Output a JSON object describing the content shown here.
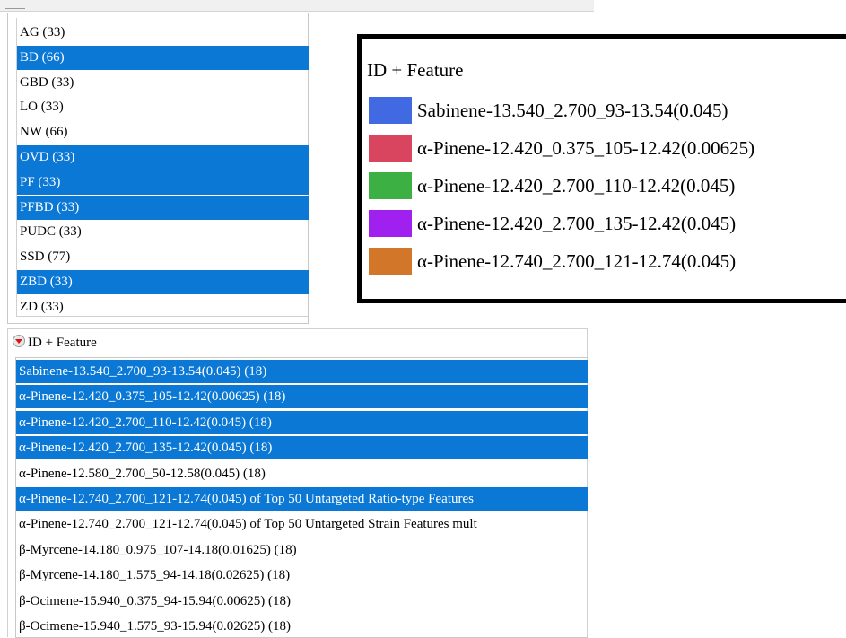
{
  "groups": [
    {
      "label": "AG (33)",
      "selected": false
    },
    {
      "label": "BD (66)",
      "selected": true
    },
    {
      "label": "GBD (33)",
      "selected": false
    },
    {
      "label": "LO (33)",
      "selected": false
    },
    {
      "label": "NW (66)",
      "selected": false
    },
    {
      "label": "OVD (33)",
      "selected": true
    },
    {
      "label": "PF (33)",
      "selected": true
    },
    {
      "label": "PFBD (33)",
      "selected": true
    },
    {
      "label": "PUDC (33)",
      "selected": false
    },
    {
      "label": "SSD (77)",
      "selected": false
    },
    {
      "label": "ZBD (33)",
      "selected": true
    },
    {
      "label": "ZD (33)",
      "selected": false
    }
  ],
  "legend": {
    "title": "ID + Feature",
    "items": [
      {
        "label": "Sabinene-13.540_2.700_93-13.54(0.045)",
        "color": "#4169e1"
      },
      {
        "label": "α-Pinene-12.420_0.375_105-12.42(0.00625)",
        "color": "#d9455f"
      },
      {
        "label": "α-Pinene-12.420_2.700_110-12.42(0.045)",
        "color": "#3cb043"
      },
      {
        "label": "α-Pinene-12.420_2.700_135-12.42(0.045)",
        "color": "#a020f0"
      },
      {
        "label": "α-Pinene-12.740_2.700_121-12.74(0.045)",
        "color": "#d2772a"
      }
    ]
  },
  "features": {
    "header": "ID + Feature",
    "items": [
      {
        "label": "Sabinene-13.540_2.700_93-13.54(0.045) (18)",
        "selected": true
      },
      {
        "label": "α-Pinene-12.420_0.375_105-12.42(0.00625) (18)",
        "selected": true
      },
      {
        "label": "α-Pinene-12.420_2.700_110-12.42(0.045) (18)",
        "selected": true
      },
      {
        "label": "α-Pinene-12.420_2.700_135-12.42(0.045) (18)",
        "selected": true
      },
      {
        "label": "α-Pinene-12.580_2.700_50-12.58(0.045) (18)",
        "selected": false
      },
      {
        "label": "α-Pinene-12.740_2.700_121-12.74(0.045) of Top 50 Untargeted Ratio-type  Features",
        "selected": true
      },
      {
        "label": "α-Pinene-12.740_2.700_121-12.74(0.045) of Top 50 Untargeted Strain Features mult",
        "selected": false
      },
      {
        "label": "β-Myrcene-14.180_0.975_107-14.18(0.01625) (18)",
        "selected": false
      },
      {
        "label": "β-Myrcene-14.180_1.575_94-14.18(0.02625) (18)",
        "selected": false
      },
      {
        "label": "β-Ocimene-15.940_0.375_94-15.94(0.00625) (18)",
        "selected": false
      },
      {
        "label": "β-Ocimene-15.940_1.575_93-15.94(0.02625) (18)",
        "selected": false
      }
    ]
  }
}
